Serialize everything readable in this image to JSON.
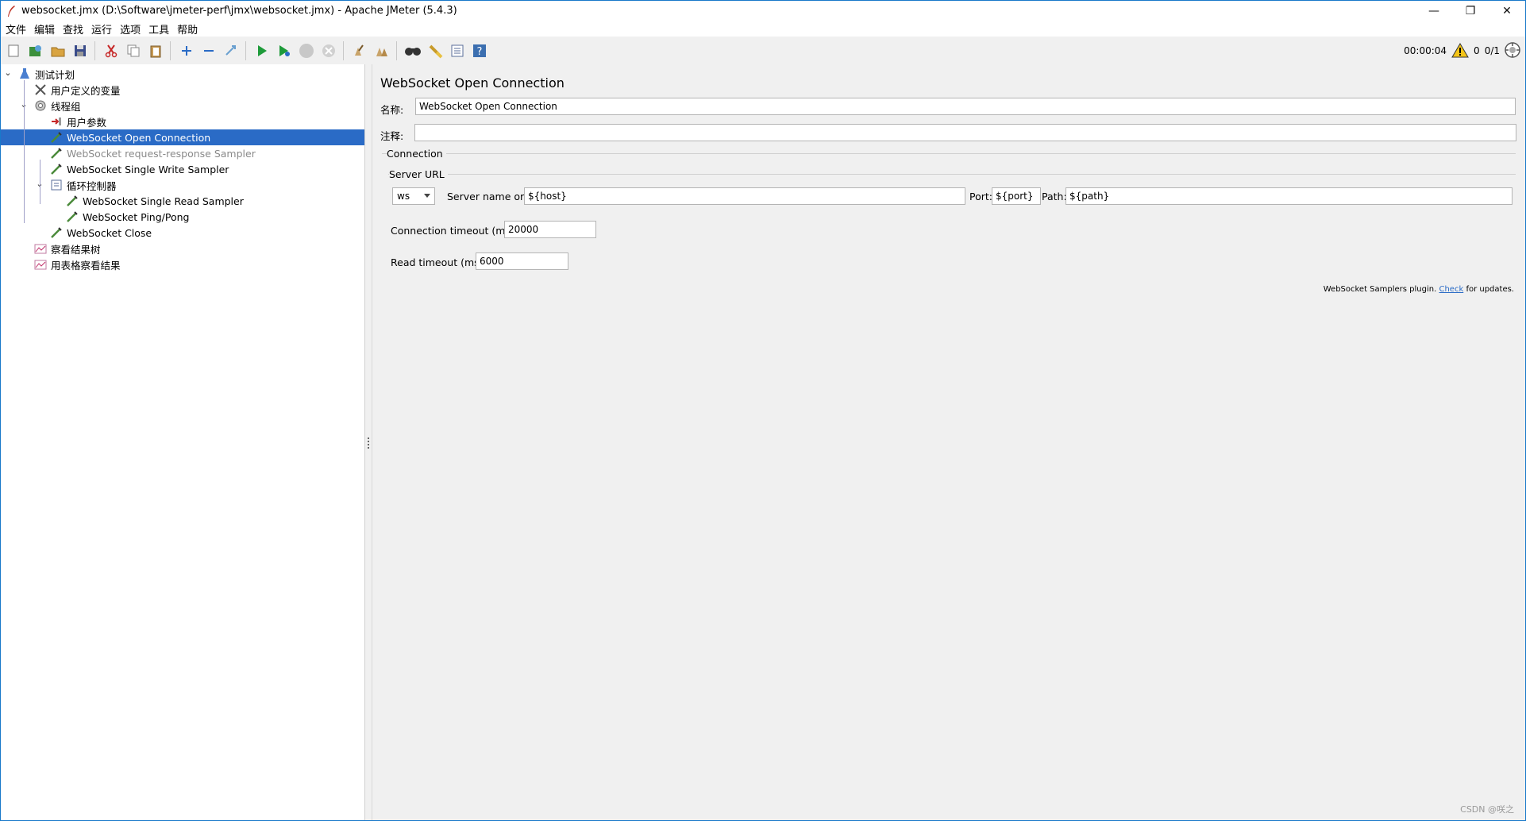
{
  "window": {
    "title": "websocket.jmx (D:\\Software\\jmeter-perf\\jmx\\websocket.jmx) - Apache JMeter (5.4.3)",
    "controls": {
      "minimize": "—",
      "restore": "❐",
      "close": "✕"
    }
  },
  "menu": [
    "文件",
    "编辑",
    "查找",
    "运行",
    "选项",
    "工具",
    "帮助"
  ],
  "toolbar": {
    "buttons": [
      "new-icon",
      "templates-icon",
      "open-icon",
      "save-icon",
      "cut-icon",
      "copy-icon",
      "paste-icon",
      "expand-icon",
      "collapse-icon",
      "toggle-icon",
      "start-icon",
      "start-no-pause-icon",
      "stop-icon",
      "shutdown-icon",
      "clear-icon",
      "clear-all-icon",
      "search-icon",
      "reset-search-icon",
      "function-helper-icon",
      "help-icon"
    ],
    "elapsed": "00:00:04",
    "warnings": "0",
    "threads": "0/1"
  },
  "tree": {
    "items": [
      {
        "label": "测试计划",
        "icon": "test-plan-icon",
        "level": 0,
        "toggle": "⌄"
      },
      {
        "label": "用户定义的变量",
        "icon": "user-vars-icon",
        "level": 1
      },
      {
        "label": "线程组",
        "icon": "thread-group-icon",
        "level": 1,
        "toggle": "⌄"
      },
      {
        "label": "用户参数",
        "icon": "user-params-icon",
        "level": 2
      },
      {
        "label": "WebSocket Open Connection",
        "icon": "sampler-icon",
        "level": 2,
        "selected": true
      },
      {
        "label": "WebSocket request-response Sampler",
        "icon": "sampler-icon",
        "level": 2,
        "disabled": true
      },
      {
        "label": "WebSocket Single Write Sampler",
        "icon": "sampler-icon",
        "level": 2
      },
      {
        "label": "循环控制器",
        "icon": "loop-controller-icon",
        "level": 2,
        "toggle": "⌄"
      },
      {
        "label": "WebSocket Single Read Sampler",
        "icon": "sampler-icon",
        "level": 3
      },
      {
        "label": "WebSocket Ping/Pong",
        "icon": "sampler-icon",
        "level": 3
      },
      {
        "label": "WebSocket Close",
        "icon": "sampler-icon",
        "level": 2
      },
      {
        "label": "察看结果树",
        "icon": "listener-icon",
        "level": 1
      },
      {
        "label": "用表格察看结果",
        "icon": "listener-icon",
        "level": 1
      }
    ]
  },
  "form": {
    "title": "WebSocket Open Connection",
    "name_label": "名称:",
    "name_value": "WebSocket Open Connection",
    "comment_label": "注释:",
    "comment_value": "",
    "connection_legend": "Connection",
    "server_url_legend": "Server URL",
    "protocol": "ws",
    "server_label": "Server name or IP:",
    "server_value": "${host}",
    "port_label": "Port:",
    "port_value": "${port}",
    "path_label": "Path:",
    "path_value": "${path}",
    "conn_timeout_label": "Connection timeout (ms):",
    "conn_timeout_value": "20000",
    "read_timeout_label": "Read timeout (ms):",
    "read_timeout_value": "6000",
    "plugin_note_prefix": "WebSocket Samplers plugin.",
    "plugin_note_link": "Check",
    "plugin_note_suffix": "for updates."
  },
  "watermark": "CSDN @咲之"
}
